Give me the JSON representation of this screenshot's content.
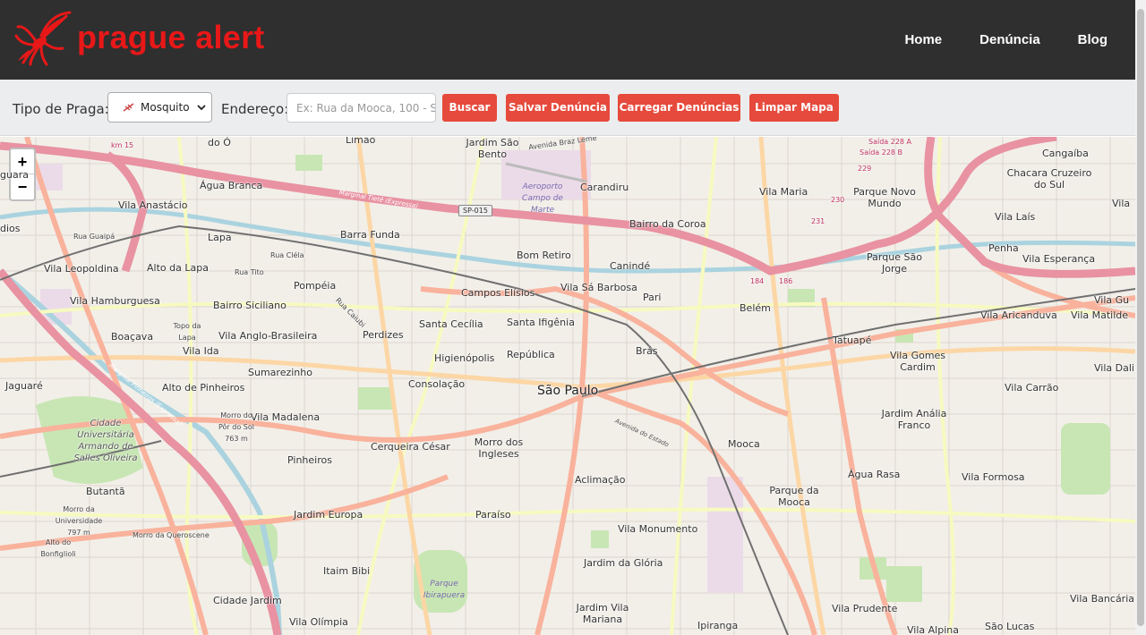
{
  "header": {
    "logo_text": "prague alert",
    "nav": [
      "Home",
      "Denúncia",
      "Blog"
    ]
  },
  "toolbar": {
    "pest_label": "Tipo de Praga:",
    "pest_selected": "Mosquito",
    "address_label": "Endereço:",
    "address_placeholder": "Ex: Rua da Mooca, 100 - S",
    "buttons": [
      "Buscar",
      "Salvar Denúncia",
      "Carregar Denúncias",
      "Limpar Mapa"
    ]
  },
  "map": {
    "zoom_in": "+",
    "zoom_out": "−",
    "shield_label": "SP-015",
    "labels": [
      "do Ó",
      "Limão",
      "Jardim São Bento",
      "Carandiru",
      "Vila Maria",
      "Parque Novo Mundo",
      "Cangaíba",
      "Chacara Cruzeiro do Sul",
      "Água Branca",
      "Vila Anastácio",
      "Lapa",
      "Barra Funda",
      "Bairro da Coroa",
      "Vila Laís",
      "Penha",
      "Vila Leopoldina",
      "Alto da Lapa",
      "Bom Retiro",
      "Canindé",
      "Parque São Jorge",
      "Vila Esperança",
      "Pompéia",
      "Campos Elísios",
      "Vila Sá Barbosa",
      "Pari",
      "Belém",
      "Vila Aricanduva",
      "Vila Matilde",
      "Vila Hamburguesa",
      "Bairro Siciliano",
      "Santa Cecília",
      "Santa Ifigênia",
      "Tatuapé",
      "Boaçava",
      "Vila Anglo-Brasileira",
      "Perdizes",
      "Brás",
      "Vila Ida",
      "Higienópolis",
      "República",
      "Vila Gomes Cardim",
      "Sumarezinho",
      "Jaguaré",
      "Alto de Pinheiros",
      "Consolação",
      "São Paulo",
      "Vila Carrão",
      "Vila Madalena",
      "Jardim Anália Franco",
      "Cerqueira César",
      "Morro dos Ingleses",
      "Mooca",
      "Pinheiros",
      "Água Rasa",
      "Butantã",
      "Aclimação",
      "Parque da Mooca",
      "Vila Formosa",
      "Jardim Europa",
      "Paraíso",
      "Vila Monumento",
      "Itaim Bibi",
      "Jardim da Glória",
      "Cidade Jardim",
      "Vila Olímpia",
      "Jardim Vila Mariana",
      "Ipiranga",
      "Vila Prudente",
      "Vila Alpina",
      "Vila Bancária",
      "São Lucas",
      "Vila Dali",
      "Vila Gu",
      "Vila",
      "dios",
      "guara"
    ],
    "small_labels": [
      "Cidade Universitária Armando de Salles Oliveira",
      "Morro do Pôr do Sol 763 m",
      "Topo da Lapa",
      "Morro da Universidade 797 m",
      "Morro da Queroscene",
      "Alto do Bonfiglioli",
      "Parque Ibirapuera",
      "Aeroporto Campo de Marte",
      "Marginal Tietê (Expressa)",
      "Marginal Pinheiros (Expressa)",
      "Avenida do Estado",
      "Rua Guaipá",
      "Rua Cléla",
      "Rua Tito",
      "Rua Caiubi",
      "Avenida Braz Leme",
      "Saída 228 A",
      "Saída 228 B",
      "km 15",
      "230",
      "231",
      "229",
      "184",
      "186"
    ]
  },
  "colors": {
    "header_bg": "#2f2f2f",
    "brand_red": "#e81818",
    "button_red": "#e64a3c",
    "toolbar_bg": "#ecedee",
    "map_bg": "#f2efe9",
    "motorway": "#e892a2",
    "trunk": "#f9b29c",
    "primary": "#fcd6a4",
    "secondary": "#f7fabf"
  }
}
